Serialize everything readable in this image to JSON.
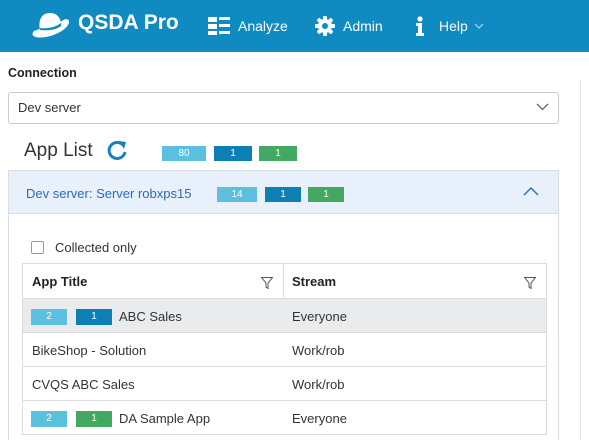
{
  "header": {
    "brand": "QSDA Pro",
    "nav": {
      "analyze": "Analyze",
      "admin": "Admin",
      "help": "Help"
    },
    "color": "#0f8bc2"
  },
  "connection": {
    "label": "Connection",
    "selected": "Dev server"
  },
  "app_list": {
    "title": "App List",
    "counts": [
      "80",
      "1",
      "1"
    ]
  },
  "server_panel": {
    "title": "Dev server: Server robxps15",
    "counts": [
      "14",
      "1",
      "1"
    ]
  },
  "filter": {
    "collected_only_label": "Collected only"
  },
  "table": {
    "headers": [
      "App Title",
      "Stream"
    ],
    "rows": [
      {
        "badges": [
          "2",
          "1"
        ],
        "badge_colors": [
          "#5bc0de",
          "#0c7fb3"
        ],
        "title": "ABC Sales",
        "stream": "Everyone",
        "selected": true
      },
      {
        "badges": [],
        "badge_colors": [],
        "title": "BikeShop - Solution",
        "stream": "Work/rob",
        "selected": false
      },
      {
        "badges": [],
        "badge_colors": [],
        "title": "CVQS ABC Sales",
        "stream": "Work/rob",
        "selected": false
      },
      {
        "badges": [
          "2",
          "1"
        ],
        "badge_colors": [
          "#5bc0de",
          "#43a862"
        ],
        "title": "DA Sample App",
        "stream": "Everyone",
        "selected": false
      }
    ]
  },
  "colors": {
    "badge_light": "#5bc0de",
    "badge_dark": "#0c7fb3",
    "badge_green": "#43a862",
    "link_blue": "#2b6cb8"
  }
}
